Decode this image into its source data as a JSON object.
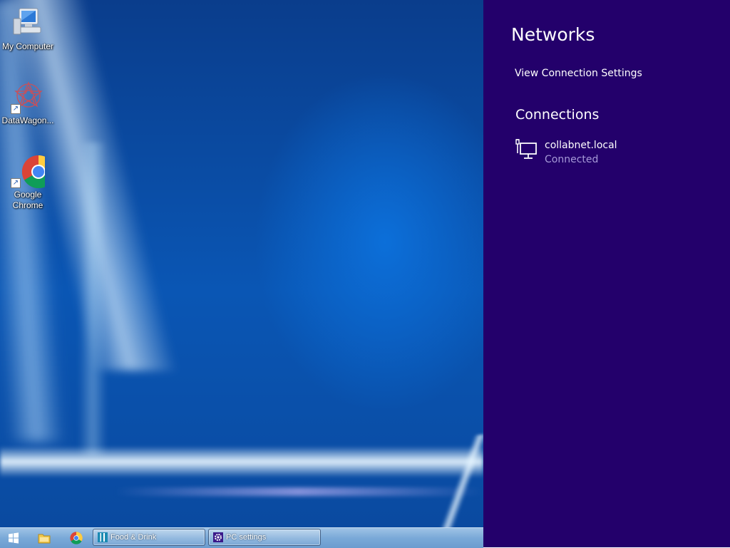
{
  "desktop": {
    "icons": [
      {
        "label": "My Computer",
        "icon": "computer-icon"
      },
      {
        "label": "DataWagon...",
        "icon": "datawagon-icon"
      },
      {
        "label": "Google Chrome",
        "icon": "chrome-icon"
      }
    ]
  },
  "taskbar": {
    "start_icon": "windows-start-icon",
    "pinned": [
      {
        "icon": "file-explorer-icon"
      },
      {
        "icon": "chrome-icon"
      }
    ],
    "tasks": [
      {
        "label": "Food & Drink",
        "icon": "food-drink-app-icon"
      },
      {
        "label": "PC settings",
        "icon": "gear-icon"
      }
    ]
  },
  "networks_panel": {
    "title": "Networks",
    "view_settings_link": "View Connection Settings",
    "connections_heading": "Connections",
    "connections": [
      {
        "name": "collabnet.local",
        "status": "Connected",
        "icon": "wired-network-icon"
      }
    ],
    "colors": {
      "background": "#23006b",
      "status_text": "#a79ad8"
    }
  }
}
